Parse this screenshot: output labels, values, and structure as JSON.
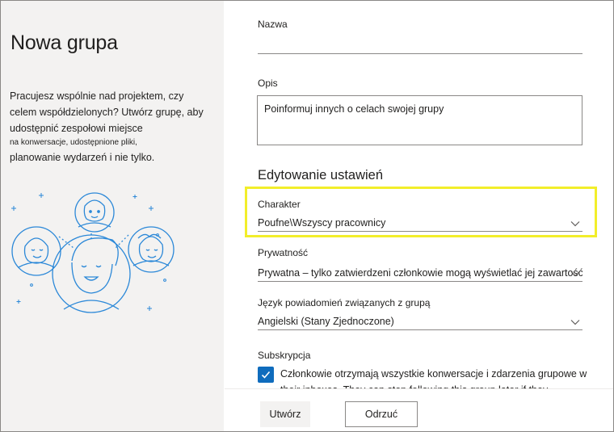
{
  "left_panel": {
    "title": "Nowa grupa",
    "description_lines": [
      "Pracujesz wspólnie nad projektem, czy",
      "celem współdzielonych? Utwórz grupę, aby",
      "udostępnić zespołowi miejsce",
      "na konwersacje, udostępnione pliki,",
      "planowanie wydarzeń i nie tylko."
    ]
  },
  "form": {
    "name_label": "Nazwa",
    "name_value": "",
    "description_label": "Opis",
    "description_placeholder": "Poinformuj innych o celach swojej grupy",
    "settings_heading": "Edytowanie ustawień",
    "classification": {
      "label": "Charakter",
      "value": "Poufne\\Wszyscy pracownicy",
      "icon": "chevron-down-icon"
    },
    "privacy": {
      "label": "Prywatność",
      "value": "Prywatna – tylko zatwierdzeni członkowie mogą wyświetlać jej zawartość",
      "icon": "chevron-down-icon"
    },
    "language": {
      "label": "Język powiadomień związanych z grupą",
      "value": "Angielski (Stany Zjednoczone)",
      "icon": "chevron-down-icon"
    },
    "subscription": {
      "label": "Subskrypcja",
      "checked": true,
      "text": "Członkowie otrzymają wszystkie konwersacje i zdarzenia grupowe w their inboxes. They can stop following this group later if they"
    }
  },
  "footer": {
    "create_label": "Utwórz",
    "cancel_label": "Odrzuć"
  },
  "colors": {
    "accent": "#0f6cbd",
    "highlight": "#f2ee2a",
    "left_panel_bg": "#f3f2f1",
    "illustration": "#2b88d8"
  }
}
